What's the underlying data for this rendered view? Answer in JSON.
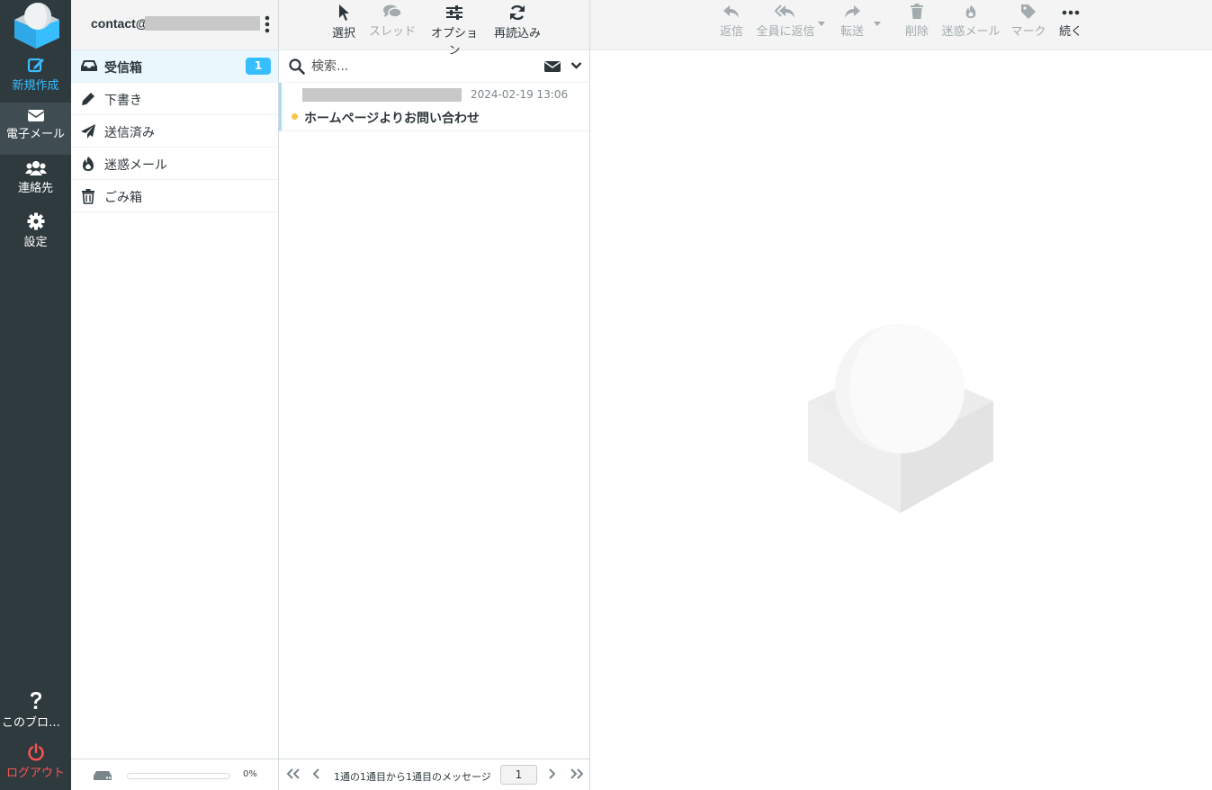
{
  "nav": {
    "compose": "新規作成",
    "mail": "電子メール",
    "contacts": "連絡先",
    "settings": "設定",
    "about": "このブログ...",
    "logout": "ログアウト"
  },
  "account": {
    "email_prefix": "contact@"
  },
  "folders": [
    {
      "name": "受信箱",
      "icon": "inbox-icon",
      "unread": "1",
      "active": true
    },
    {
      "name": "下書き",
      "icon": "pencil-icon"
    },
    {
      "name": "送信済み",
      "icon": "paper-plane-icon"
    },
    {
      "name": "迷惑メール",
      "icon": "fire-icon"
    },
    {
      "name": "ごみ箱",
      "icon": "trash-icon"
    }
  ],
  "quota": {
    "percent": "0%",
    "fill": 0
  },
  "list_toolbar": {
    "select": "選択",
    "threads": "スレッド",
    "options": "オプション",
    "refresh": "再読込み"
  },
  "search": {
    "placeholder": "検索..."
  },
  "messages": [
    {
      "date": "2024-02-19 13:06",
      "subject": "ホームページよりお問い合わせ",
      "unread": true
    }
  ],
  "pager": {
    "info": "1通の1通目から1通目のメッセージ",
    "page": "1"
  },
  "content_toolbar": {
    "reply": "返信",
    "reply_all": "全員に返信",
    "forward": "転送",
    "delete": "削除",
    "junk": "迷惑メール",
    "mark": "マーク",
    "more": "続く"
  },
  "colors": {
    "accent": "#37beff",
    "rail": "#2f3a3f",
    "logout": "#ff5552",
    "unread_dot": "#f7c548"
  }
}
